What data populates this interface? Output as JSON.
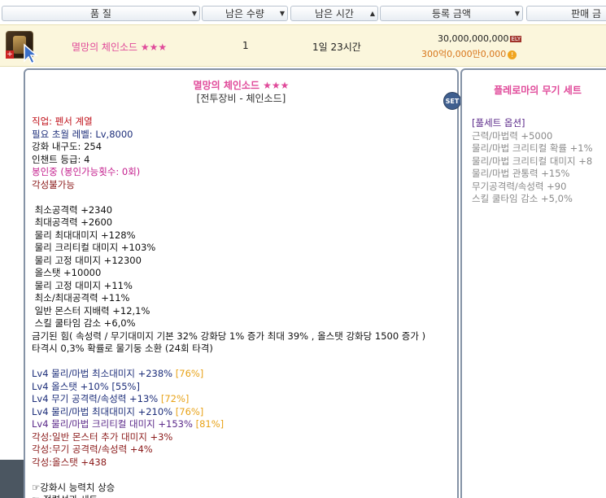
{
  "header": {
    "col_grade": "품 질",
    "col_qty": "남은 수량",
    "col_time": "남은 시간",
    "col_price": "등록 금액",
    "col_seller": "판매 금"
  },
  "row": {
    "name": "멸망의 체인소드 ★★★",
    "qty": "1",
    "time": "1일 23시간",
    "price": "30,000,000,000",
    "price_tag": "ELY",
    "price_korean": "300억0,000만0,000"
  },
  "tooltip": {
    "title": "멸망의 체인소드 ★★★",
    "subtitle": "[전투장비 - 체인소드]",
    "set_badge": "SET",
    "lines": [
      {
        "text": "직업: 펜서 계열",
        "cls": "red"
      },
      {
        "text": "필요 초월 레벨: Lv,8000",
        "cls": "navy"
      },
      {
        "text": "강화 내구도: 254",
        "cls": "blk"
      },
      {
        "text": "인챈트 등급: 4",
        "cls": "blk"
      },
      {
        "text": "봉인중 (봉인가능횟수: 0회)",
        "cls": "pink"
      },
      {
        "text": "각성불가능",
        "cls": "darkred"
      },
      {
        "text": "",
        "cls": "blk"
      },
      {
        "text": " 최소공격력 +2340",
        "cls": "blk"
      },
      {
        "text": " 최대공격력 +2600",
        "cls": "blk"
      },
      {
        "text": " 물리 최대대미지 +128%",
        "cls": "blk"
      },
      {
        "text": " 물리 크리티컬 대미지 +103%",
        "cls": "blk"
      },
      {
        "text": " 물리 고정 대미지 +12300",
        "cls": "blk"
      },
      {
        "text": " 올스탯 +10000",
        "cls": "blk"
      },
      {
        "text": " 물리 고정 대미지 +11%",
        "cls": "blk"
      },
      {
        "text": " 최소/최대공격력 +11%",
        "cls": "blk"
      },
      {
        "text": " 일반 몬스터 지배력 +12,1%",
        "cls": "blk"
      },
      {
        "text": " 스킬 쿨타임 감소 +6,0%",
        "cls": "blk"
      },
      {
        "text": "금기된 힘( 속성력 / 무기대미지 기본 32% 강화당 1% 증가 최대 39% , 올스탯 강화당 1500 증가 )",
        "cls": "blk"
      },
      {
        "text": "타격시 0,3% 확률로 물기둥 소환 (24회 타격)",
        "cls": "blk"
      },
      {
        "text": "",
        "cls": "blk"
      }
    ],
    "options": [
      {
        "text": "Lv4 물리/마법 최소대미지 +238%",
        "bracket": "[76%]",
        "cls": "navy",
        "bcls": "gold"
      },
      {
        "text": "Lv4 올스탯 +10%",
        "bracket": "[55%]",
        "cls": "navy",
        "bcls": "navy"
      },
      {
        "text": "Lv4 무기 공격력/속성력 +13%",
        "bracket": "[72%]",
        "cls": "navy",
        "bcls": "gold"
      },
      {
        "text": "Lv4 물리/마법 최대대미지 +210%",
        "bracket": "[76%]",
        "cls": "navy",
        "bcls": "gold"
      },
      {
        "text": "Lv4 물리/마법 크리티컬 대미지 +153%",
        "bracket": "[81%]",
        "cls": "purple",
        "bcls": "gold"
      }
    ],
    "awaken": [
      {
        "text": "각성:일반 몬스터 추가 대미지 +3%",
        "cls": "darkred"
      },
      {
        "text": "각성:무기 공격력/속성력 +4%",
        "cls": "darkred"
      },
      {
        "text": "각성:올스탯 +438",
        "cls": "darkred"
      }
    ],
    "footer": [
      {
        "text": "",
        "cls": "blk"
      },
      {
        "text": "☞강화시 능력치 상승",
        "cls": "blk"
      },
      {
        "text": "☞ 정령석과 세트",
        "cls": "blk"
      }
    ]
  },
  "set_tooltip": {
    "title": "플레로마의 무기 세트",
    "lines": [
      {
        "text": "[풀세트 옵션]",
        "cls": "purple"
      },
      {
        "text": "근력/마법력 +5000",
        "cls": "gray"
      },
      {
        "text": "물리/마법 크리티컬 확률 +1%",
        "cls": "gray"
      },
      {
        "text": "물리/마법 크리티컬 대미지 +8",
        "cls": "gray"
      },
      {
        "text": "물리/마법 관통력 +15%",
        "cls": "gray"
      },
      {
        "text": "무기공격력/속성력 +90",
        "cls": "gray"
      },
      {
        "text": "스킬 쿨타임 감소 +5,0%",
        "cls": "gray"
      }
    ]
  },
  "icons": {
    "item": "chain-sword-icon",
    "cursor": "cursor-arrow-icon",
    "coin": "gold-coin-icon"
  }
}
